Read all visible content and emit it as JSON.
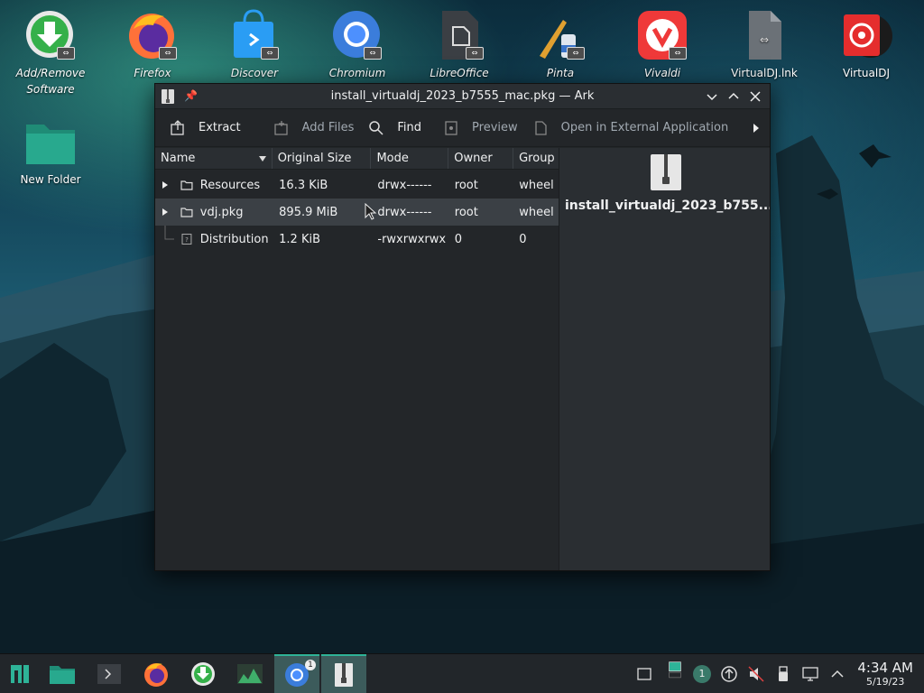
{
  "desktop": {
    "icons": [
      {
        "label": "Add/Remove Software",
        "line1": "Add/Remove",
        "line2": "Software",
        "italic": true
      },
      {
        "label": "Firefox",
        "italic": true
      },
      {
        "label": "Discover",
        "italic": true
      },
      {
        "label": "Chromium",
        "italic": true
      },
      {
        "label": "LibreOffice",
        "italic": true
      },
      {
        "label": "Pinta",
        "italic": true
      },
      {
        "label": "Vivaldi",
        "italic": true
      },
      {
        "label": "VirtualDJ.lnk",
        "italic": false
      },
      {
        "label": "VirtualDJ",
        "italic": false
      },
      {
        "label": "New Folder",
        "italic": false
      }
    ],
    "link_badge": "⇔"
  },
  "window": {
    "title": "install_virtualdj_2023_b7555_mac.pkg — Ark",
    "toolbar": {
      "extract": "Extract",
      "add_files": "Add Files",
      "find": "Find",
      "preview": "Preview",
      "open_external": "Open in External Application"
    },
    "columns": [
      "Name",
      "Original Size",
      "Mode",
      "Owner",
      "Group"
    ],
    "rows": [
      {
        "name": "Resources",
        "size": "16.3 KiB",
        "mode": "drwx------",
        "owner": "root",
        "group": "wheel"
      },
      {
        "name": "vdj.pkg",
        "size": "895.9 MiB",
        "mode": "drwx------",
        "owner": "root",
        "group": "wheel"
      },
      {
        "name": "Distribution",
        "size": "1.2 KiB",
        "mode": "-rwxrwxrwx",
        "owner": "0",
        "group": "0"
      }
    ],
    "preview_name": "install_virtualdj_2023_b755..."
  },
  "taskbar": {
    "chromium_badge": "1",
    "virtual_desktop": "1",
    "time": "4:34 AM",
    "date": "5/19/23"
  },
  "colors": {
    "accent": "#2eb398",
    "window_bg": "#232629",
    "hover_row": "#3b4045"
  }
}
